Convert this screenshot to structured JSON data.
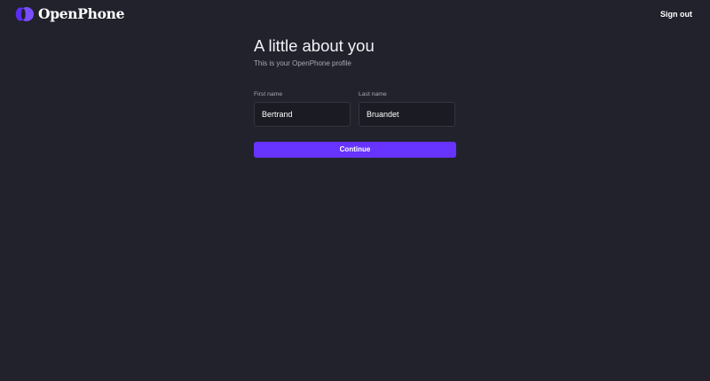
{
  "header": {
    "brand_name": "OpenPhone",
    "logo_icon": "openphone-logo-icon",
    "sign_out_label": "Sign out"
  },
  "profile_form": {
    "title": "A little about you",
    "subtitle": "This is your OpenPhone profile",
    "first_name": {
      "label": "First name",
      "value": "Bertrand"
    },
    "last_name": {
      "label": "Last name",
      "value": "Bruandet"
    },
    "continue_label": "Continue"
  },
  "colors": {
    "background": "#21222c",
    "accent": "#6633ff",
    "input_background": "#1a1b23"
  }
}
